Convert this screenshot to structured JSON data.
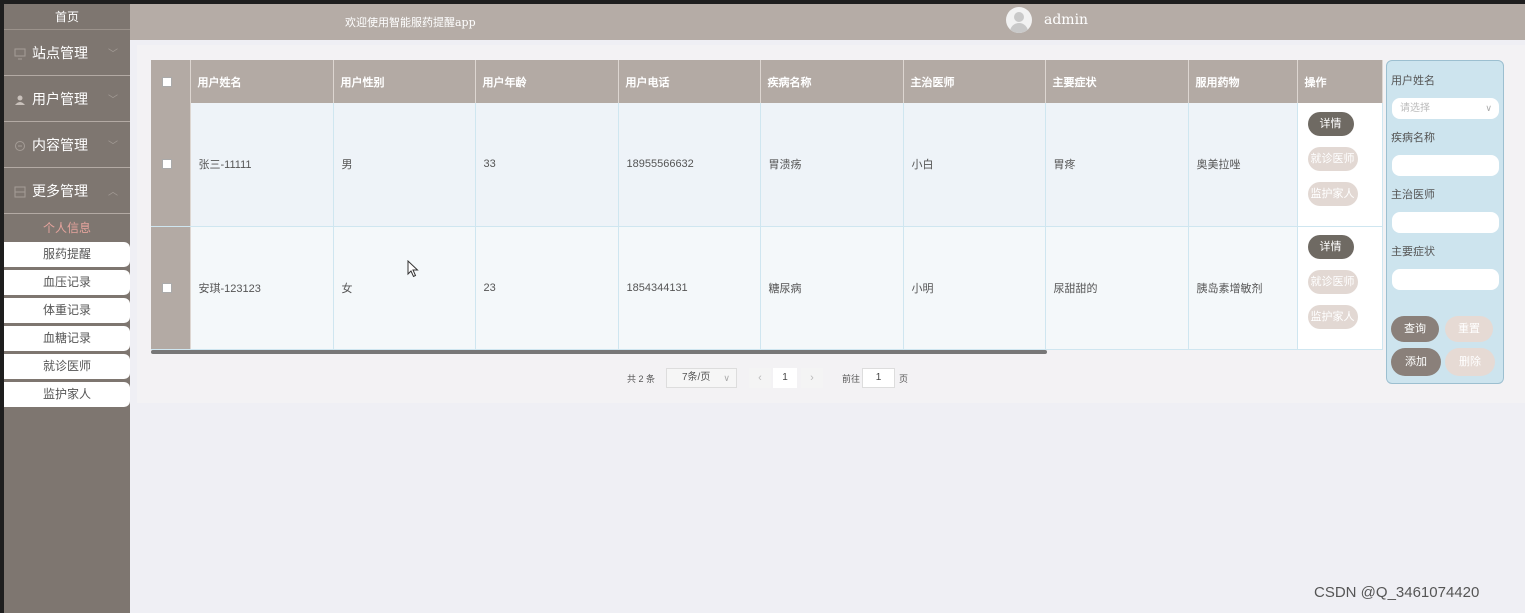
{
  "sidebar": {
    "home": "首页",
    "groups": [
      {
        "label": "站点管理",
        "icon": "monitor-icon"
      },
      {
        "label": "用户管理",
        "icon": "user-icon"
      },
      {
        "label": "内容管理",
        "icon": "chat-icon"
      },
      {
        "label": "更多管理",
        "icon": "grid-icon"
      }
    ],
    "sub_title": "个人信息",
    "sub_items": [
      "服药提醒",
      "血压记录",
      "体重记录",
      "血糖记录",
      "就诊医师",
      "监护家人"
    ]
  },
  "header": {
    "title": "欢迎使用智能服药提醒app",
    "user": "admin"
  },
  "table": {
    "columns": [
      "用户姓名",
      "用户性别",
      "用户年龄",
      "用户电话",
      "疾病名称",
      "主治医师",
      "主要症状",
      "服用药物",
      "操作"
    ],
    "rows": [
      {
        "name": "张三-11111",
        "gender": "男",
        "age": "33",
        "phone": "18955566632",
        "disease": "胃溃疡",
        "doctor": "小白",
        "symptom": "胃疼",
        "drug": "奥美拉唑"
      },
      {
        "name": "安琪-123123",
        "gender": "女",
        "age": "23",
        "phone": "1854344131",
        "disease": "糖尿病",
        "doctor": "小明",
        "symptom": "尿甜甜的",
        "drug": "胰岛素增敏剂"
      }
    ],
    "actions": {
      "detail": "详情",
      "visit": "就诊医师",
      "guardian": "监护家人"
    }
  },
  "pagination": {
    "total": "共 2 条",
    "page_size": "7条/页",
    "prev": "‹",
    "current": "1",
    "next": "›",
    "goto_label": "前往",
    "goto_value": "1",
    "page_suffix": "页"
  },
  "search": {
    "fields": [
      {
        "label": "用户姓名",
        "placeholder": "请选择"
      },
      {
        "label": "疾病名称",
        "placeholder": ""
      },
      {
        "label": "主治医师",
        "placeholder": ""
      },
      {
        "label": "主要症状",
        "placeholder": ""
      }
    ],
    "buttons": {
      "query": "查询",
      "reset": "重置",
      "add": "添加",
      "delete": "删除"
    }
  },
  "watermark": "CSDN @Q_3461074420",
  "colors": {
    "sidebar": "#7e7670",
    "header": "#b5aca6",
    "table_header": "#b3aaa4",
    "search_panel": "#cde4ee",
    "accent_pink": "#e4a39c"
  }
}
